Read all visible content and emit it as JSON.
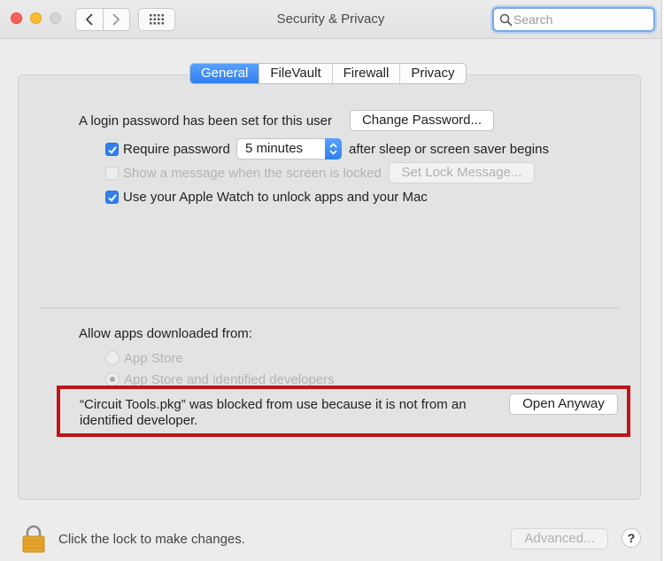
{
  "window": {
    "title": "Security & Privacy",
    "search_placeholder": "Search"
  },
  "tabs": [
    {
      "label": "General",
      "active": true
    },
    {
      "label": "FileVault",
      "active": false
    },
    {
      "label": "Firewall",
      "active": false
    },
    {
      "label": "Privacy",
      "active": false
    }
  ],
  "general": {
    "login_text": "A login password has been set for this user",
    "change_password_label": "Change Password...",
    "require_password_label": "Require password",
    "require_password_checked": true,
    "require_password_value": "5 minutes",
    "after_sleep_text": "after sleep or screen saver begins",
    "show_message_label": "Show a message when the screen is locked",
    "show_message_checked": false,
    "set_lock_message_label": "Set Lock Message...",
    "apple_watch_label": "Use your Apple Watch to unlock apps and your Mac",
    "apple_watch_checked": true
  },
  "apps": {
    "allow_text": "Allow apps downloaded from:",
    "option_app_store": "App Store",
    "option_identified": "App Store and identified developers",
    "selected": "App Store and identified developers",
    "blocked_message": "“Circuit Tools.pkg” was blocked from use because it is not from an identified developer.",
    "open_anyway_label": "Open Anyway"
  },
  "footer": {
    "lock_text": "Click the lock to make changes.",
    "advanced_label": "Advanced...",
    "help_label": "?"
  },
  "colors": {
    "accent": "#2f80ed",
    "highlight_border": "#c0141b"
  }
}
